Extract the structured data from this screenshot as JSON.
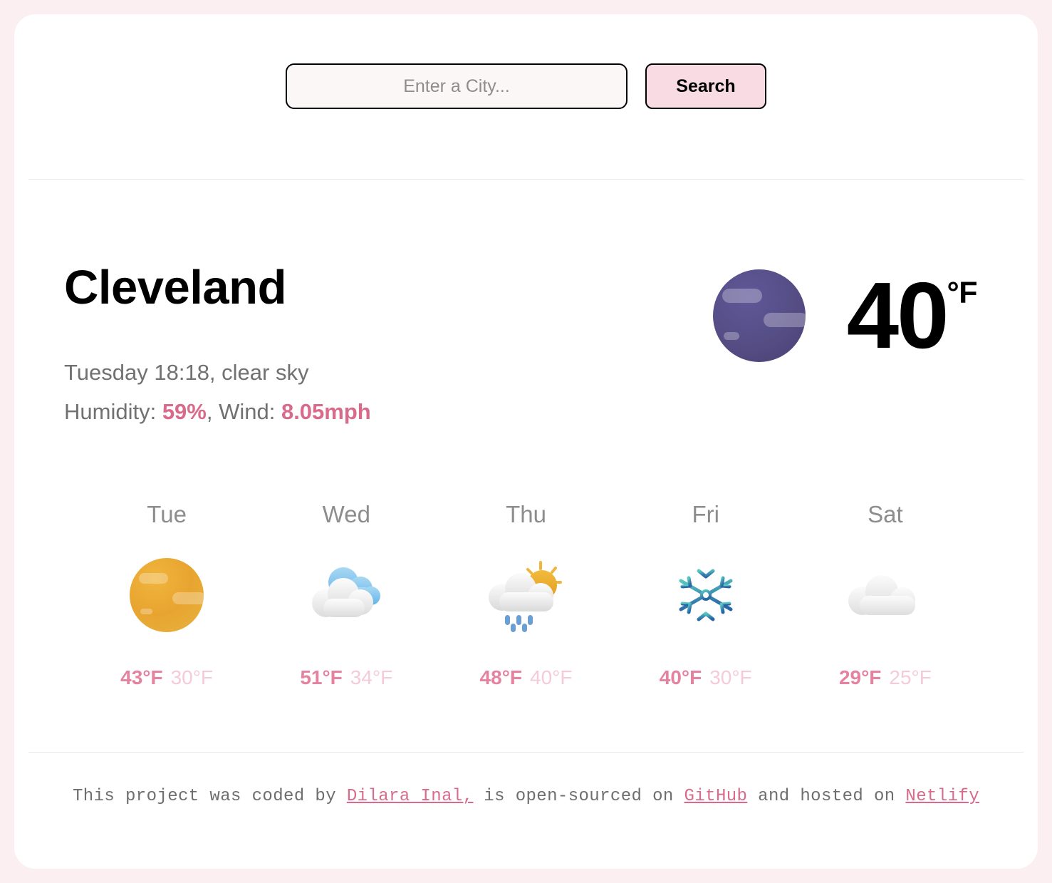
{
  "search": {
    "placeholder": "Enter a City...",
    "value": "",
    "button_label": "Search"
  },
  "current": {
    "city": "Cleveland",
    "datetime_description": "Tuesday 18:18, clear sky",
    "humidity_label": "Humidity: ",
    "humidity_value": "59%",
    "separator": ", ",
    "wind_label": "Wind: ",
    "wind_value": "8.05mph",
    "temperature": "40",
    "unit": "°F",
    "icon": "night-clear-icon"
  },
  "forecast": [
    {
      "day": "Tue",
      "icon": "sun-icon",
      "max": "43°F",
      "min": "30°F"
    },
    {
      "day": "Wed",
      "icon": "cloudy-icon",
      "max": "51°F",
      "min": "34°F"
    },
    {
      "day": "Thu",
      "icon": "sun-rain-cloud-icon",
      "max": "48°F",
      "min": "40°F"
    },
    {
      "day": "Fri",
      "icon": "snowflake-icon",
      "max": "40°F",
      "min": "30°F"
    },
    {
      "day": "Sat",
      "icon": "cloud-icon",
      "max": "29°F",
      "min": "25°F"
    }
  ],
  "footer": {
    "part1": "This project was coded by ",
    "link1": "Dilara Inal,",
    "part2": " is open-sourced on ",
    "link2": "GitHub",
    "part3": " and hosted on ",
    "link3": "Netlify"
  },
  "colors": {
    "page_background": "#fbeff2",
    "card_background": "#ffffff",
    "accent_pink": "#d96a8b",
    "button_pink": "#f9dbe3",
    "temp_max": "#e5829f",
    "temp_min": "#f4cbd8",
    "muted_text": "#8d8d8d"
  }
}
